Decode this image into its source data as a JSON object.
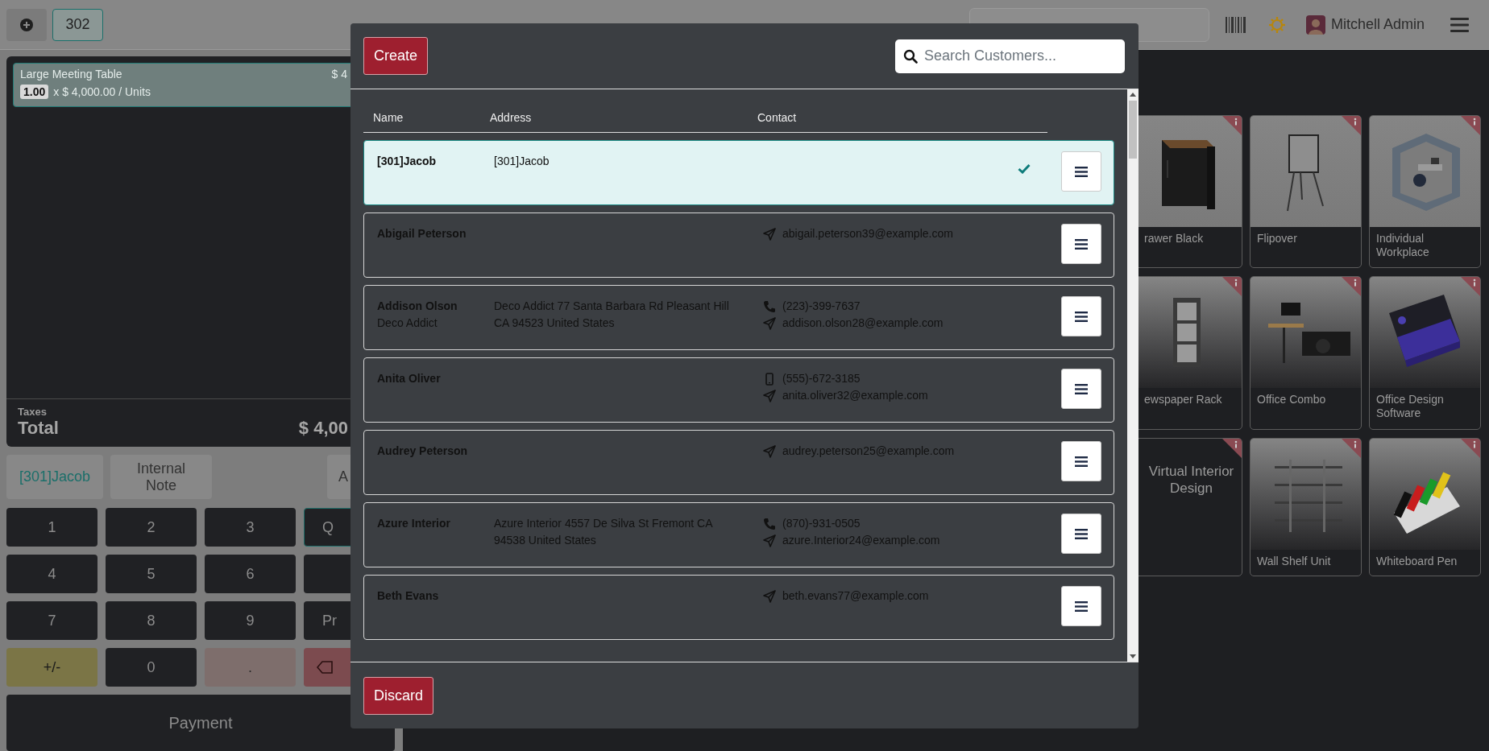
{
  "top_bar": {
    "order_tabs": [
      {
        "label": "302",
        "selected": true
      }
    ],
    "user_name": "Mitchell Admin"
  },
  "order": {
    "lines": [
      {
        "product": "Large Meeting Table",
        "price": "$ 4",
        "quantity": "1.00",
        "unit_price": "x $ 4,000.00 / Units",
        "selected": true
      }
    ],
    "taxes_label": "Taxes",
    "total_label": "Total",
    "total": "$ 4,00"
  },
  "action_buttons": [
    {
      "label": "[301]Jacob",
      "kind": "customer"
    },
    {
      "label": "Internal Note",
      "kind": "note"
    },
    {
      "label": "A",
      "kind": "action"
    }
  ],
  "numpad": {
    "keys": [
      {
        "label": "1",
        "kind": "digit"
      },
      {
        "label": "2",
        "kind": "digit"
      },
      {
        "label": "3",
        "kind": "digit"
      },
      {
        "label": "4",
        "kind": "digit"
      },
      {
        "label": "5",
        "kind": "digit"
      },
      {
        "label": "6",
        "kind": "digit"
      },
      {
        "label": "7",
        "kind": "digit"
      },
      {
        "label": "8",
        "kind": "digit"
      },
      {
        "label": "9",
        "kind": "digit"
      },
      {
        "label": "+/-",
        "kind": "sign"
      },
      {
        "label": "0",
        "kind": "digit"
      },
      {
        "label": ".",
        "kind": "decimal"
      }
    ],
    "modes": [
      {
        "label": "Q",
        "selected": true
      },
      {
        "selected": false
      },
      {
        "label": "Pr",
        "selected": false
      }
    ]
  },
  "payment_button": "Payment",
  "products": [
    {
      "name": "rawer Black",
      "kind": "picture"
    },
    {
      "name": "Flipover",
      "kind": "picture"
    },
    {
      "name": "Individual Workplace",
      "kind": "picture"
    },
    {
      "name": "ewspaper Rack",
      "kind": "picture"
    },
    {
      "name": "Office Combo",
      "kind": "picture"
    },
    {
      "name": "Office Design Software",
      "kind": "picture"
    },
    {
      "name": "Virtual Interior Design",
      "kind": "text"
    },
    {
      "name": "Wall Shelf Unit",
      "kind": "picture"
    },
    {
      "name": "Whiteboard Pen",
      "kind": "picture"
    }
  ],
  "dialog": {
    "create_button": "Create",
    "search": {
      "placeholder": "Search Customers..."
    },
    "columns": [
      "Name",
      "Address",
      "Contact"
    ],
    "customers": [
      {
        "name": "[301]Jacob",
        "address_lines": [
          "[301]Jacob"
        ],
        "selected": true
      },
      {
        "name": "Abigail Peterson",
        "contacts": [
          {
            "kind": "email",
            "value": "abigail.peterson39@example.com"
          }
        ],
        "selected": false
      },
      {
        "name": "Addison Olson",
        "company": "Deco Addict",
        "address_lines": [
          "Deco Addict 77 Santa Barbara Rd Pleasant Hill",
          "CA 94523 United States"
        ],
        "contacts": [
          {
            "kind": "phone",
            "value": "(223)-399-7637"
          },
          {
            "kind": "email",
            "value": "addison.olson28@example.com"
          }
        ],
        "selected": false
      },
      {
        "name": "Anita Oliver",
        "contacts": [
          {
            "kind": "mobile",
            "value": "(555)-672-3185"
          },
          {
            "kind": "email",
            "value": "anita.oliver32@example.com"
          }
        ],
        "selected": false
      },
      {
        "name": "Audrey Peterson",
        "contacts": [
          {
            "kind": "email",
            "value": "audrey.peterson25@example.com"
          }
        ],
        "selected": false
      },
      {
        "name": "Azure Interior",
        "address_lines": [
          "Azure Interior 4557 De Silva St Fremont CA",
          "94538 United States"
        ],
        "contacts": [
          {
            "kind": "phone",
            "value": "(870)-931-0505"
          },
          {
            "kind": "email",
            "value": "azure.Interior24@example.com"
          }
        ],
        "selected": false
      },
      {
        "name": "Beth Evans",
        "contacts": [
          {
            "kind": "email",
            "value": "beth.evans77@example.com"
          }
        ],
        "selected": false
      }
    ],
    "discard_button": "Discard"
  }
}
